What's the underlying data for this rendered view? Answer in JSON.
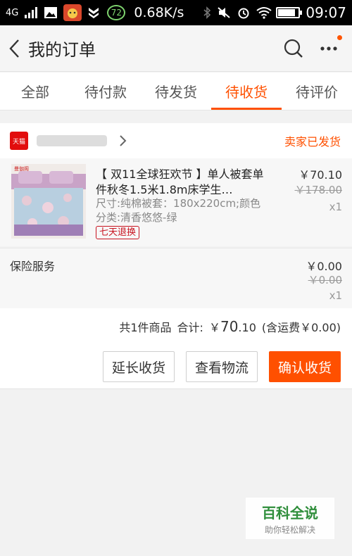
{
  "status_bar": {
    "network": "4G",
    "speed": "0.68K/s",
    "badge": "72",
    "time": "09:07",
    "battery_level": 0.85
  },
  "header": {
    "title": "我的订单"
  },
  "tabs": [
    {
      "label": "全部"
    },
    {
      "label": "待付款"
    },
    {
      "label": "待发货"
    },
    {
      "label": "待收货",
      "active": true
    },
    {
      "label": "待评价"
    }
  ],
  "order": {
    "shop_logo": "天猫",
    "status": "卖家已发货",
    "item": {
      "title": "【 双11全球狂欢节 】",
      "title2": "单人被套单件秋冬1.5米1.8m床学生…",
      "sku_size": "尺寸:纯棉被套：180x220cm;颜色",
      "sku_category": "分类:清香悠悠-绿",
      "tag": "七天退换",
      "price": "￥70.10",
      "original_price": "￥178.00",
      "quantity": "x1",
      "image_brand": "曼伽阁"
    },
    "insurance": {
      "label": "保险服务",
      "price": "￥0.00",
      "original_price": "￥0.00",
      "quantity": "x1"
    },
    "summary": {
      "count_text": "共1件商品",
      "total_label": "合计:",
      "total_symbol": "￥",
      "total_int": "70",
      "total_dec": ".10",
      "shipping": "(含运费￥0.00)"
    },
    "actions": {
      "extend": "延长收货",
      "logistics": "查看物流",
      "confirm": "确认收货"
    }
  },
  "watermark": {
    "main": "百科全说",
    "sub": "助你轻松解决"
  },
  "colors": {
    "accent": "#ff5000",
    "tmall_red": "#e20d0d",
    "tag_red": "#c8131f",
    "watermark_green": "#2f8e3b"
  }
}
